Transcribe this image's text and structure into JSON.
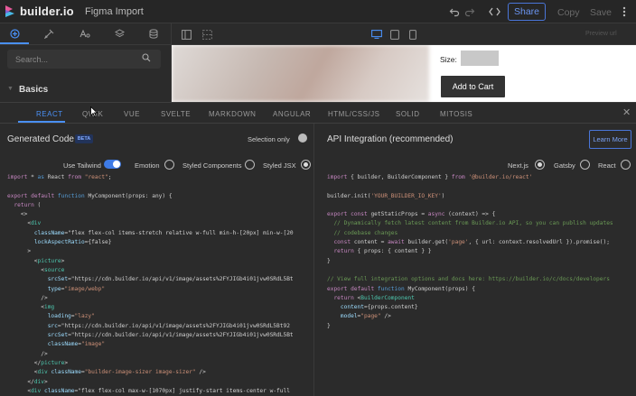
{
  "app": {
    "brand": "builder.io",
    "doc_title": "Figma Import"
  },
  "toolbar": {
    "share_label": "Share",
    "copy_label": "Copy",
    "save_label": "Save"
  },
  "subbar": {
    "preview_label": "Preview url"
  },
  "left_panel": {
    "search_placeholder": "Search...",
    "section_label": "Basics"
  },
  "preview": {
    "size_label": "Size:",
    "add_to_cart_label": "Add to Cart"
  },
  "frameworks": [
    "REACT",
    "QWIK",
    "VUE",
    "SVELTE",
    "MARKDOWN",
    "ANGULAR",
    "HTML/CSS/JS",
    "SOLID",
    "MITOSIS"
  ],
  "active_framework": "REACT",
  "generated": {
    "title": "Generated Code",
    "beta": "BETA",
    "selection_only_label": "Selection only",
    "options": {
      "use_tailwind": "Use Tailwind",
      "emotion": "Emotion",
      "styled_components": "Styled Components",
      "styled_jsx": "Styled JSX"
    },
    "code": [
      "import * as React from \"react\";",
      "",
      "export default function MyComponent(props: any) {",
      "  return (",
      "    <>",
      "      <div",
      "        className=\"flex flex-col items-stretch relative w-full min-h-[20px] min-w-[20",
      "        lockAspectRatio={false}",
      "      >",
      "        <picture>",
      "          <source",
      "            srcSet=\"https://cdn.builder.io/api/v1/image/assets%2FYJIGb4i01jvw0SRdL5Bt",
      "            type=\"image/webp\"",
      "          />",
      "          <img",
      "            loading=\"lazy\"",
      "            src=\"https://cdn.builder.io/api/v1/image/assets%2FYJIGb4i01jvw0SRdL5Bt92",
      "            srcSet=\"https://cdn.builder.io/api/v1/image/assets%2FYJIGb4i01jvw0SRdL5Bt",
      "            className=\"image\"",
      "          />",
      "        </picture>",
      "        <div className=\"builder-image-sizer image-sizer\" />",
      "      </div>",
      "      <div className=\"flex flex-col max-w-[1070px] justify-start items-center w-full",
      "        <div className=\"max-w-[34px] text-black text-[16px] tracking-[0] text-left"
    ]
  },
  "integration": {
    "title": "API Integration (recommended)",
    "learn_more": "Learn More",
    "options": {
      "nextjs": "Next.js",
      "gatsby": "Gatsby",
      "react": "React"
    },
    "code": [
      "import { builder, BuilderComponent } from '@builder.io/react'",
      "",
      "builder.init('YOUR_BUILDER_IO_KEY')",
      "",
      "export const getStaticProps = async (context) => {",
      "  // Dynamically fetch latest content from Builder.io API, so you can publish updates",
      "  // codebase changes",
      "  const content = await builder.get('page', { url: context.resolvedUrl }).promise();",
      "  return { props: { content } }",
      "}",
      "",
      "// View full integration options and docs here: https://builder.io/c/docs/developers",
      "export default function MyComponent(props) {",
      "  return <BuilderComponent",
      "    content={props.content}",
      "    model=\"page\" />",
      "}"
    ]
  },
  "colors": {
    "accent": "#4a90f5",
    "background": "#2b2b2b",
    "topbar": "#262626"
  }
}
